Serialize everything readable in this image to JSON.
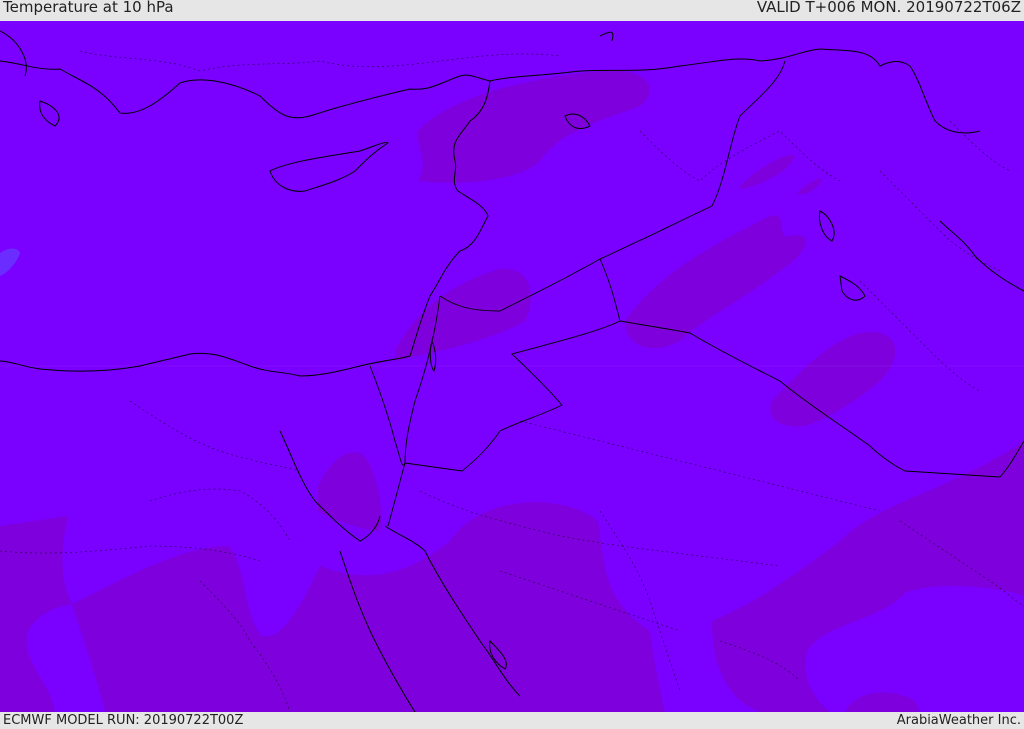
{
  "header": {
    "title": "Temperature at 10 hPa",
    "valid_time": "VALID T+006 MON. 20190722T06Z"
  },
  "footer": {
    "model_run": "ECMWF MODEL RUN: 20190722T00Z",
    "credit": "ArabiaWeather Inc."
  },
  "colors": {
    "background_fill": "#7a00ff",
    "warmer_patch_fill": "#7e00dc",
    "cooler_patch_fill": "#6a2cff",
    "coastline": "#000000",
    "bar_background": "#e6e6e6"
  }
}
